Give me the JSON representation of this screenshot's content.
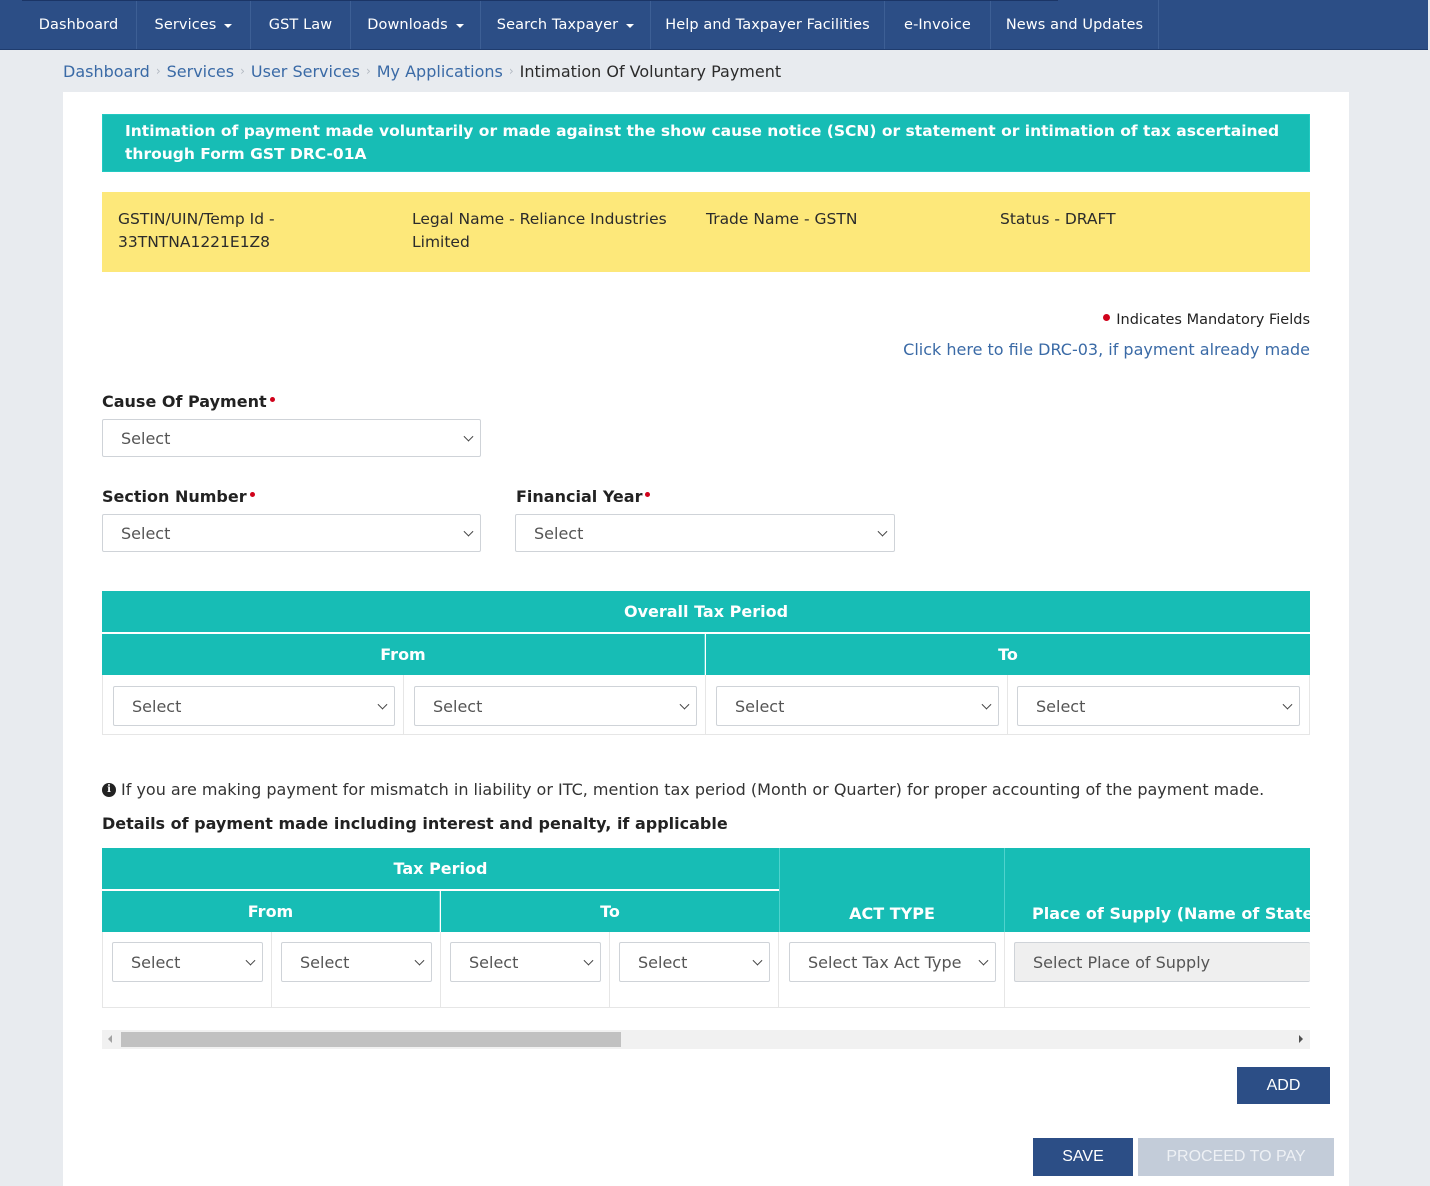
{
  "nav": {
    "items": [
      {
        "label": "Dashboard",
        "dropdown": false
      },
      {
        "label": "Services",
        "dropdown": true
      },
      {
        "label": "GST Law",
        "dropdown": false
      },
      {
        "label": "Downloads",
        "dropdown": true
      },
      {
        "label": "Search Taxpayer",
        "dropdown": true
      },
      {
        "label": "Help and Taxpayer Facilities",
        "dropdown": false
      },
      {
        "label": "e-Invoice",
        "dropdown": false
      },
      {
        "label": "News and Updates",
        "dropdown": false
      }
    ]
  },
  "breadcrumb": {
    "items": [
      "Dashboard",
      "Services",
      "User Services",
      "My Applications"
    ],
    "current": "Intimation Of Voluntary Payment"
  },
  "banner": {
    "title": "Intimation of payment made voluntarily or made against the show cause notice (SCN) or statement or intimation of tax ascertained through Form GST DRC-01A"
  },
  "taxpayer_info": {
    "gstin": "GSTIN/UIN/Temp Id - 33TNTNA1221E1Z8",
    "legal_name": "Legal Name - Reliance Industries Limited",
    "trade_name": "Trade Name - GSTN",
    "status": "Status - DRAFT"
  },
  "mandatory_note": "Indicates Mandatory Fields",
  "drc03_link": "Click here to file DRC-03, if payment already made",
  "form": {
    "cause_of_payment": {
      "label": "Cause Of Payment",
      "value": "Select"
    },
    "section_number": {
      "label": "Section Number",
      "value": "Select"
    },
    "financial_year": {
      "label": "Financial Year",
      "value": "Select"
    }
  },
  "overall_tax_period": {
    "title": "Overall Tax Period",
    "from_label": "From",
    "to_label": "To",
    "selects": [
      "Select",
      "Select",
      "Select",
      "Select"
    ]
  },
  "info_note": "If you are making payment for mismatch in liability or ITC, mention tax period (Month or Quarter) for proper accounting of the payment made.",
  "details_heading": "Details of payment made including interest and penalty, if applicable",
  "details_table": {
    "tax_period_label": "Tax Period",
    "from_label": "From",
    "to_label": "To",
    "act_type_label": "ACT TYPE",
    "place_of_supply_label": "Place of Supply (Name of State",
    "period_selects": [
      "Select",
      "Select",
      "Select",
      "Select"
    ],
    "act_type_value": "Select Tax Act Type",
    "place_of_supply_value": "Select Place of Supply"
  },
  "buttons": {
    "add": "ADD",
    "save": "SAVE",
    "proceed": "PROCEED TO PAY"
  }
}
